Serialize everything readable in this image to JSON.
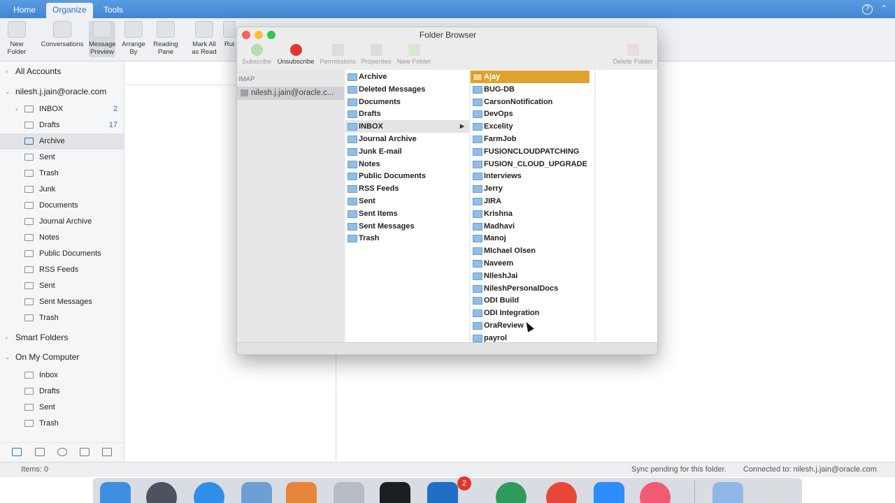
{
  "ribbon_tabs": {
    "home": "Home",
    "organize": "Organize",
    "tools": "Tools"
  },
  "ribbon": {
    "new_folder": [
      "New",
      "Folder"
    ],
    "conversations": "Conversations",
    "message_preview": [
      "Message",
      "Preview"
    ],
    "arrange_by": [
      "Arrange",
      "By"
    ],
    "reading_pane": [
      "Reading",
      "Pane"
    ],
    "mark_all_as_read": [
      "Mark All",
      "as Read"
    ],
    "rules": "Rul"
  },
  "sidebar": {
    "all_accounts": "All Accounts",
    "account": "nilesh.j.jain@oracle.com",
    "folders": [
      {
        "label": "INBOX",
        "count": "2"
      },
      {
        "label": "Drafts",
        "count": "17"
      },
      {
        "label": "Archive",
        "count": ""
      },
      {
        "label": "Sent",
        "count": ""
      },
      {
        "label": "Trash",
        "count": ""
      },
      {
        "label": "Junk",
        "count": ""
      },
      {
        "label": "Documents",
        "count": ""
      },
      {
        "label": "Journal Archive",
        "count": ""
      },
      {
        "label": "Notes",
        "count": ""
      },
      {
        "label": "Public Documents",
        "count": ""
      },
      {
        "label": "RSS Feeds",
        "count": ""
      },
      {
        "label": "Sent",
        "count": ""
      },
      {
        "label": "Sent Messages",
        "count": ""
      },
      {
        "label": "Trash",
        "count": ""
      }
    ],
    "smart_folders": "Smart Folders",
    "on_my_computer": "On My Computer",
    "local_folders": [
      "Inbox",
      "Drafts",
      "Sent",
      "Trash"
    ]
  },
  "status": {
    "items": "Items: 0",
    "sync": "Sync pending for this folder.",
    "connected": "Connected to: nilesh.j.jain@oracle.com"
  },
  "dock": {
    "outlook_badge": "2"
  },
  "dialog": {
    "title": "Folder Browser",
    "toolbar": {
      "subscribe": "Subscribe",
      "unsubscribe": "Unsubscribe",
      "permissions": "Permissions",
      "properties": "Properties",
      "new_folder": "New Folder",
      "delete_folder": "Delete Folder"
    },
    "account_header": "IMAP",
    "account": "nilesh.j.jain@oracle.c...",
    "column1": [
      "Archive",
      "Deleted Messages",
      "Documents",
      "Drafts",
      "INBOX",
      "Journal Archive",
      "Junk E-mail",
      "Notes",
      "Public Documents",
      "RSS Feeds",
      "Sent",
      "Sent Items",
      "Sent Messages",
      "Trash"
    ],
    "column2": [
      "Ajay",
      "BUG-DB",
      "CarsonNotification",
      "DevOps",
      "Excelity",
      "FarmJob",
      "FUSIONCLOUDPATCHING",
      "FUSION_CLOUD_UPGRADE",
      "Interviews",
      "Jerry",
      "JIRA",
      "Krishna",
      "Madhavi",
      "Manoj",
      "MIchael Olsen",
      "Naveem",
      "NIleshJai",
      "NileshPersonalDocs",
      "ODI Build",
      "ODI Integration",
      "OraReview",
      "payrol"
    ]
  },
  "colors": {
    "ribbon_blue": "#4a90d9",
    "selection_orange": "#e0a32e",
    "count_blue": "#2f6fbf"
  }
}
